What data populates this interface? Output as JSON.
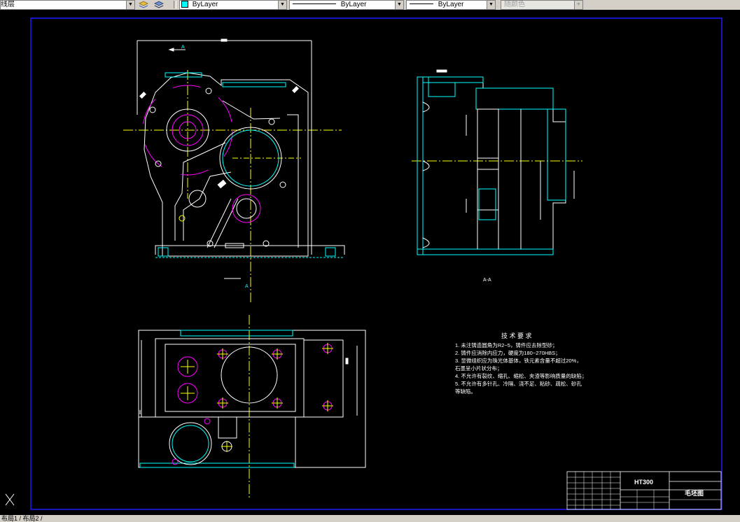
{
  "toolbar": {
    "layer_combo": {
      "value": "线层",
      "icon": "layer-state-icon"
    },
    "color_combo": {
      "value": "ByLayer",
      "color": "#00ffff"
    },
    "linetype_combo": {
      "value": "ByLayer"
    },
    "lineweight_combo": {
      "value": "ByLayer"
    },
    "plotstyle_combo": {
      "value": "随颜色"
    }
  },
  "drawing": {
    "section_label_top": "A",
    "section_label_bottom": "A",
    "section_view_label": "A-A",
    "tech_title": "技  术  要  求",
    "tech_items": [
      "1.  未注铸造圆角为R2~5，铸件应去除型砂；",
      "2.  铸件应消除内应力，硬度为180~270HBS；",
      "3.  显微组织应为珠光体基体，铁元素含量不超过20%，",
      "     石墨呈小片状分布；",
      "4.  不允许有裂纹、缩孔、缩松、夹渣等影响质量的缺陷；",
      "5.  不允许有多针孔、冷隔、浇不足、粘砂、疏松、砂孔",
      "     等缺陷。"
    ],
    "title_block": {
      "material": "HT300",
      "part_name": "毛坯图"
    },
    "colors": {
      "outline": "#ffffff",
      "hidden": "#00ffff",
      "magenta": "#ff00ff",
      "yellow": "#ffff00",
      "border": "#0000ff"
    }
  },
  "status": {
    "tabs": "布局1 / 布局2 /"
  }
}
